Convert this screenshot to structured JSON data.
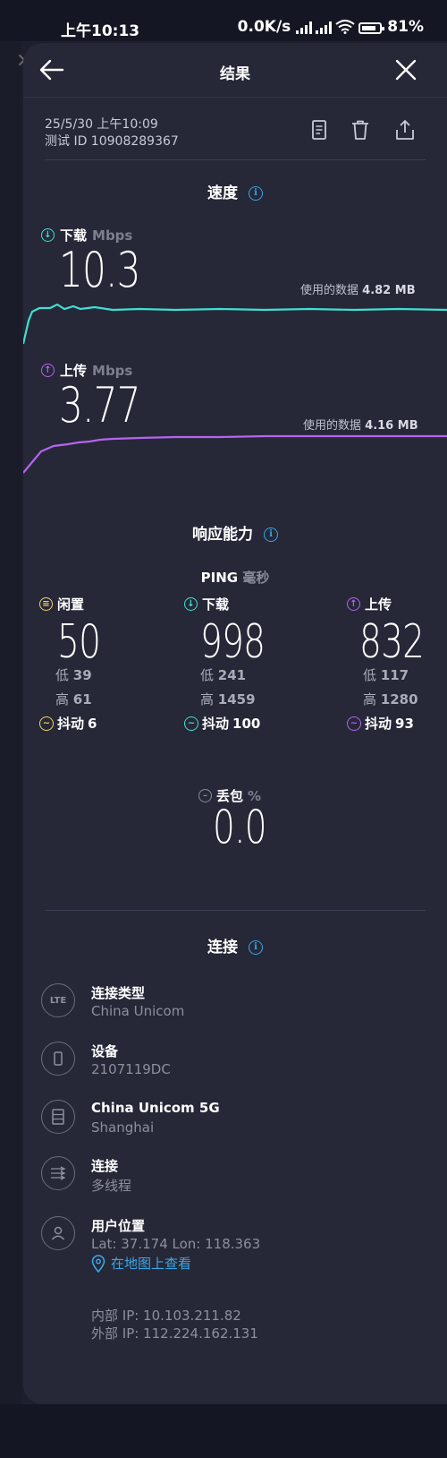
{
  "status_bar": {
    "time": "上午10:13",
    "network_speed": "0.0K/s",
    "battery": "81%"
  },
  "header": {
    "title": "结果",
    "back_icon": "arrow-left-icon",
    "close_icon": "close-icon"
  },
  "result_meta": {
    "datetime": "25/5/30 上午10:09",
    "test_id": "测试 ID 10908289367"
  },
  "actions": [
    "document-icon",
    "trash-icon",
    "share-icon"
  ],
  "speed": {
    "title": "速度",
    "download": {
      "label": "下载",
      "unit": "Mbps",
      "value": "10.3",
      "data_used": "使用的数据",
      "data_used_value": "4.82 MB",
      "color": "#3fe0d0"
    },
    "upload": {
      "label": "上传",
      "unit": "Mbps",
      "value": "3.77",
      "data_used": "使用的数据",
      "data_used_value": "4.16 MB",
      "color": "#b464f0"
    }
  },
  "responsiveness": {
    "title": "响应能力",
    "ping_label": "PING",
    "ping_unit": "毫秒",
    "idle": {
      "label": "闲置",
      "value": "50",
      "low_label": "低",
      "low": "39",
      "high_label": "高",
      "high": "61",
      "jitter_label": "抖动",
      "jitter": "6",
      "color": "#f3d36b"
    },
    "download": {
      "label": "下载",
      "value": "998",
      "low_label": "低",
      "low": "241",
      "high_label": "高",
      "high": "1459",
      "jitter_label": "抖动",
      "jitter": "100",
      "color": "#3fe0d0"
    },
    "upload": {
      "label": "上传",
      "value": "832",
      "low_label": "低",
      "low": "117",
      "high_label": "高",
      "high": "1280",
      "jitter_label": "抖动",
      "jitter": "93",
      "color": "#b464f0"
    }
  },
  "packet_loss": {
    "label": "丢包",
    "unit": "%",
    "value": "0.0"
  },
  "connection": {
    "title": "连接",
    "items": [
      {
        "icon": "lte-icon",
        "icon_text": "LTE",
        "title": "连接类型",
        "subtitle": "China Unicom"
      },
      {
        "icon": "phone-icon",
        "title": "设备",
        "subtitle": "2107119DC"
      },
      {
        "icon": "server-icon",
        "title": "China Unicom 5G",
        "subtitle": "Shanghai"
      },
      {
        "icon": "multi-thread-icon",
        "title": "连接",
        "subtitle": "多线程"
      },
      {
        "icon": "user-icon",
        "title": "用户位置",
        "subtitle": "Lat: 37.174 Lon: 118.363"
      }
    ],
    "map_link": "在地图上查看",
    "internal_ip": "内部 IP: 10.103.211.82",
    "external_ip": "外部 IP: 112.224.162.131"
  }
}
